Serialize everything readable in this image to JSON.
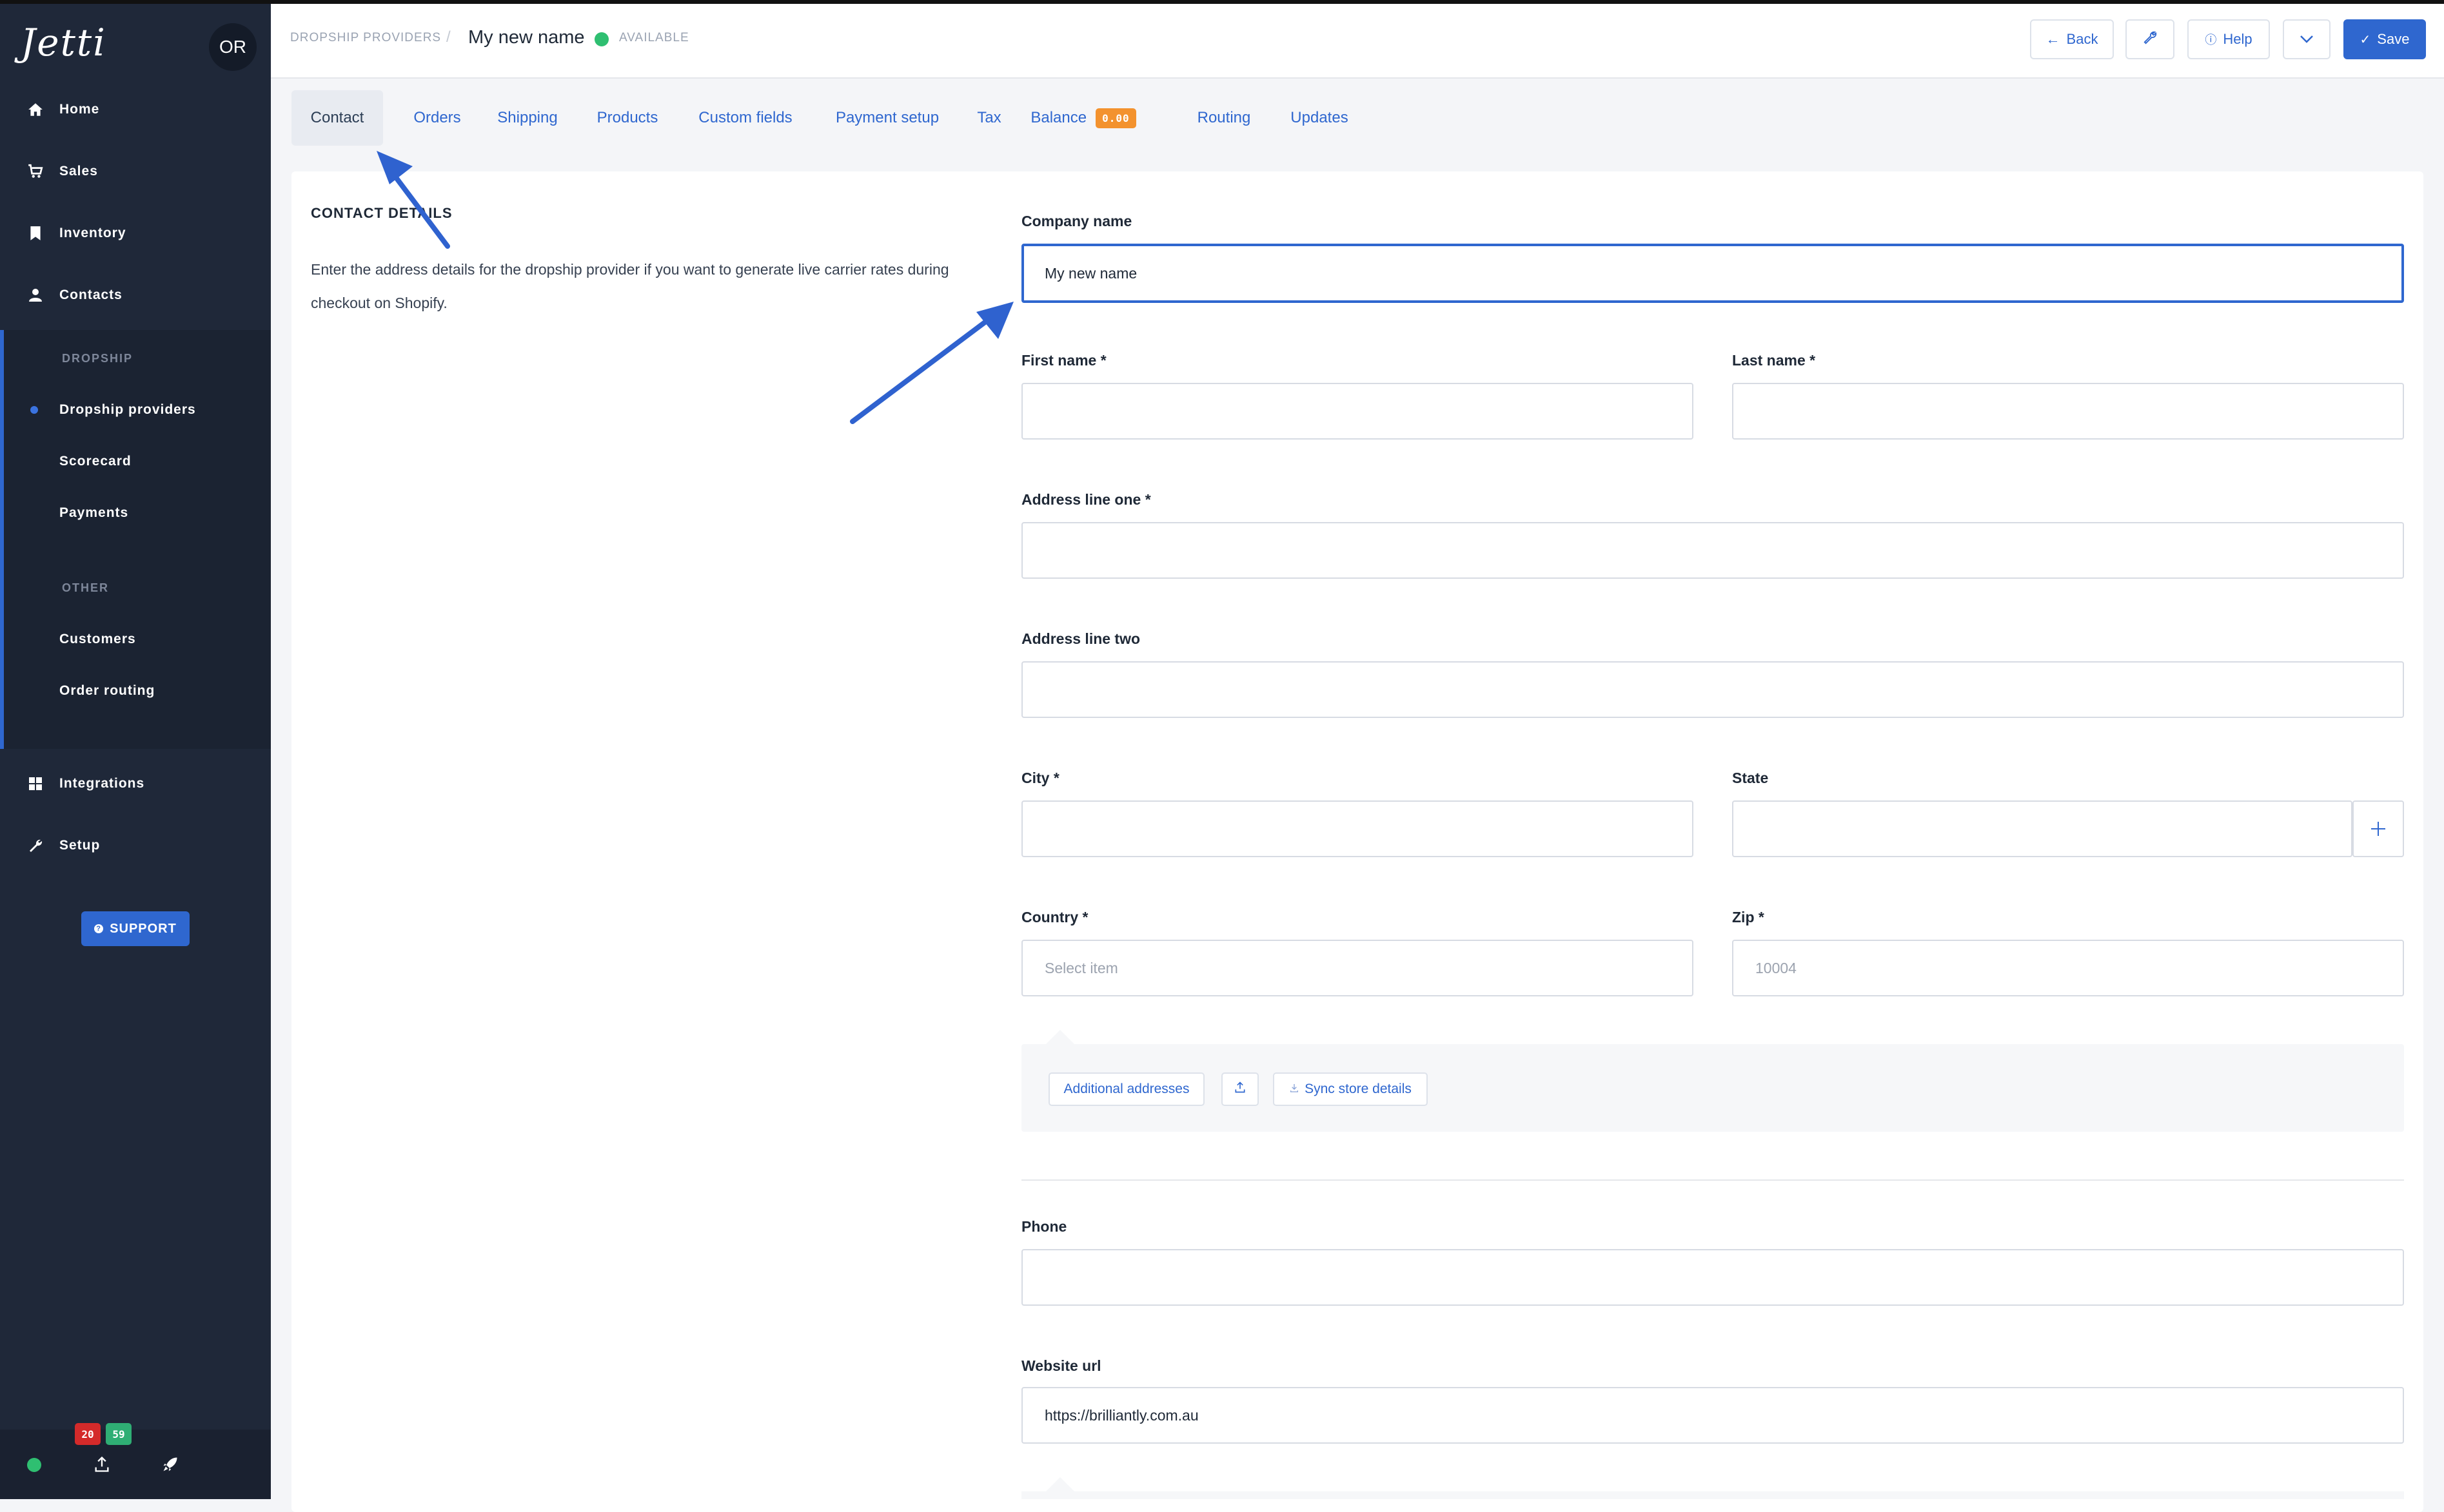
{
  "app": {
    "logo": "Jetti",
    "avatar_initials": "OR"
  },
  "sidebar": {
    "items_top": [
      {
        "label": "Home",
        "icon": "home-icon"
      },
      {
        "label": "Sales",
        "icon": "cart-icon"
      },
      {
        "label": "Inventory",
        "icon": "bookmark-icon"
      },
      {
        "label": "Contacts",
        "icon": "user-icon"
      }
    ],
    "section_dropship": "DROPSHIP",
    "dropship_items": [
      "Dropship providers",
      "Scorecard",
      "Payments"
    ],
    "section_other": "OTHER",
    "other_items": [
      "Customers",
      "Order routing"
    ],
    "items_bottom": [
      {
        "label": "Integrations",
        "icon": "grid-icon"
      },
      {
        "label": "Setup",
        "icon": "wrench-icon"
      }
    ],
    "support_label": "SUPPORT",
    "badges": {
      "red": "20",
      "green": "59"
    }
  },
  "header": {
    "breadcrumb": "DROPSHIP PROVIDERS",
    "separator": "/",
    "title": "My new name",
    "status": "AVAILABLE",
    "back_label": "Back",
    "help_label": "Help",
    "save_label": "Save"
  },
  "tabs": [
    "Contact",
    "Orders",
    "Shipping",
    "Products",
    "Custom fields",
    "Payment setup",
    "Tax",
    "Balance",
    "Routing",
    "Updates"
  ],
  "balance_badge": "0.00",
  "contact": {
    "section_title": "CONTACT DETAILS",
    "description": "Enter the address details for the dropship provider if you want to generate live carrier rates during checkout on Shopify."
  },
  "form": {
    "company_name": {
      "label": "Company name",
      "value": "My new name"
    },
    "first_name": {
      "label": "First name *",
      "value": ""
    },
    "last_name": {
      "label": "Last name *",
      "value": ""
    },
    "address_one": {
      "label": "Address line one *",
      "value": ""
    },
    "address_two": {
      "label": "Address line two",
      "value": ""
    },
    "city": {
      "label": "City *",
      "value": ""
    },
    "state": {
      "label": "State",
      "value": ""
    },
    "country": {
      "label": "Country *",
      "placeholder": "Select item"
    },
    "zip": {
      "label": "Zip *",
      "placeholder": "10004"
    },
    "phone": {
      "label": "Phone",
      "value": ""
    },
    "website": {
      "label": "Website url",
      "value": "https://brilliantly.com.au"
    }
  },
  "address_actions": {
    "additional": "Additional addresses",
    "sync": "Sync store details"
  },
  "colors": {
    "accent": "#2f67cf",
    "sidebar": "#1f2839",
    "available": "#2fbf71",
    "badge_orange": "#f3922e"
  }
}
